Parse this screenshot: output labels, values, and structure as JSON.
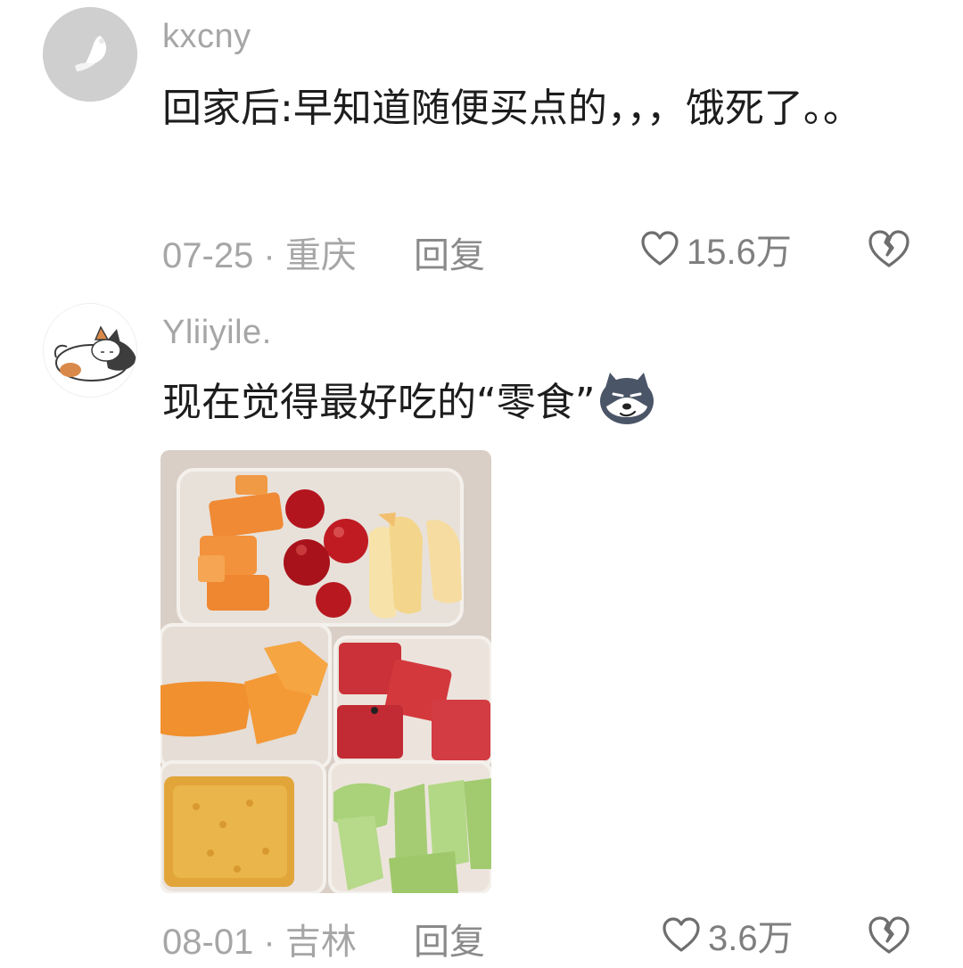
{
  "comments": [
    {
      "username": "kxcny",
      "text": "回家后:早知道随便买点的，，，饿死了。。",
      "date_location": "07-25 · 重庆",
      "reply_label": "回复",
      "likes": "15.6万",
      "avatar_icon": "white-bird-avatar-icon"
    },
    {
      "username": "Yliiyile.",
      "text": "现在觉得最好吃的“零食”",
      "date_location": "08-01 · 吉林",
      "reply_label": "回复",
      "likes": "3.6万",
      "avatar_icon": "sleeping-cat-avatar-icon",
      "emoji": "husky-smirk-emoji",
      "image": "fruit-container-photo"
    }
  ],
  "colors": {
    "text": "#1d1d1d",
    "meta": "#a6a6a6",
    "background": "#ffffff"
  }
}
